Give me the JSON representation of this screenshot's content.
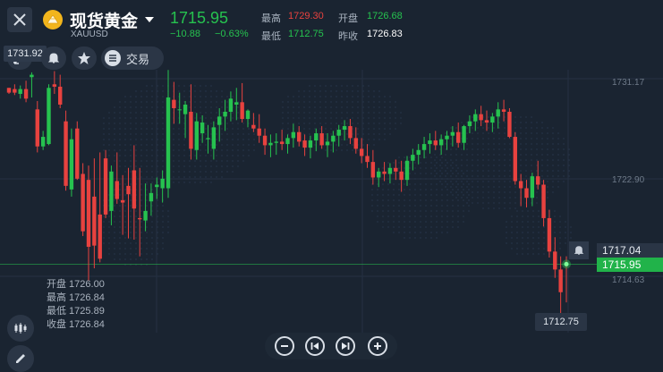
{
  "header": {
    "title": "现货黄金",
    "symbol": "XAUUSD",
    "price": "1715.95",
    "change": "−10.88",
    "change_pct": "−0.63%",
    "stats": {
      "high_label": "最高",
      "high_value": "1729.30",
      "open_label": "开盘",
      "open_value": "1726.68",
      "low_label": "最低",
      "low_value": "1712.75",
      "prev_label": "昨收",
      "prev_value": "1726.83"
    }
  },
  "toolbar": {
    "trade_label": "交易",
    "top_left_price": "1731.92"
  },
  "axis": {
    "labels": [
      "1731.17",
      "1722.90",
      "1714.63"
    ],
    "current_high": "1717.04",
    "current": "1715.95",
    "low_marker": "1712.75"
  },
  "ohlc": {
    "open": "开盘 1726.00",
    "high": "最高 1726.84",
    "low": "最低 1725.89",
    "close": "收盘 1726.84"
  },
  "colors": {
    "up": "#26c24f",
    "down": "#e8423f",
    "background": "#1a2431",
    "current_price_bg": "#21b34a"
  },
  "controls": [
    "zoom-out",
    "step-back",
    "step-forward",
    "zoom-in"
  ],
  "chart_data": {
    "type": "candlestick",
    "y_axis": {
      "ticks": [
        1731.17,
        1722.9,
        1714.63
      ]
    },
    "last": 1715.95,
    "low": 1712.75,
    "candles": [
      [
        1730.7,
        1730.7,
        1730.2,
        1730.3
      ],
      [
        1730.6,
        1731.0,
        1730.1,
        1730.3
      ],
      [
        1730.2,
        1730.9,
        1729.8,
        1730.6
      ],
      [
        1730.6,
        1731.3,
        1729.5,
        1729.8
      ],
      [
        1731.6,
        1732.0,
        1729.9,
        1731.8
      ],
      [
        1728.9,
        1729.6,
        1725.3,
        1725.8
      ],
      [
        1725.8,
        1727.1,
        1725.5,
        1726.6
      ],
      [
        1726.0,
        1731.0,
        1725.9,
        1730.7
      ],
      [
        1731.0,
        1732.1,
        1730.2,
        1730.8
      ],
      [
        1730.8,
        1731.8,
        1729.0,
        1729.3
      ],
      [
        1727.9,
        1728.8,
        1722.1,
        1722.5
      ],
      [
        1722.2,
        1727.3,
        1721.6,
        1726.4
      ],
      [
        1727.3,
        1727.9,
        1723.0,
        1723.1
      ],
      [
        1723.5,
        1724.4,
        1718.3,
        1718.7
      ],
      [
        1723.0,
        1724.2,
        1714.6,
        1717.4
      ],
      [
        1721.6,
        1724.8,
        1715.6,
        1717.5
      ],
      [
        1720.1,
        1725.3,
        1716.1,
        1716.4
      ],
      [
        1724.8,
        1725.5,
        1719.8,
        1720.1
      ],
      [
        1720.4,
        1724.2,
        1719.2,
        1723.7
      ],
      [
        1722.9,
        1725.3,
        1721.0,
        1721.4
      ],
      [
        1721.3,
        1723.4,
        1718.4,
        1721.1
      ],
      [
        1722.5,
        1724.0,
        1718.1,
        1721.8
      ],
      [
        1723.8,
        1725.9,
        1718.0,
        1720.6
      ],
      [
        1719.8,
        1724.0,
        1716.6,
        1719.7
      ],
      [
        1719.6,
        1722.7,
        1718.7,
        1720.4
      ],
      [
        1721.2,
        1722.7,
        1720.0,
        1721.9
      ],
      [
        1722.4,
        1723.2,
        1721.4,
        1722.6
      ],
      [
        1722.3,
        1723.8,
        1721.1,
        1723.1
      ],
      [
        1722.3,
        1732.2,
        1721.5,
        1729.9
      ],
      [
        1729.7,
        1731.2,
        1727.7,
        1729.0
      ],
      [
        1728.9,
        1730.3,
        1727.7,
        1728.9
      ],
      [
        1728.5,
        1729.6,
        1726.5,
        1729.3
      ],
      [
        1728.7,
        1731.0,
        1724.7,
        1725.6
      ],
      [
        1725.5,
        1728.6,
        1724.7,
        1727.9
      ],
      [
        1726.9,
        1728.4,
        1726.1,
        1727.8
      ],
      [
        1726.4,
        1727.6,
        1725.2,
        1726.5
      ],
      [
        1725.6,
        1727.9,
        1724.7,
        1727.4
      ],
      [
        1727.6,
        1729.0,
        1726.2,
        1728.3
      ],
      [
        1728.3,
        1729.7,
        1727.1,
        1728.7
      ],
      [
        1728.7,
        1730.4,
        1727.9,
        1729.8
      ],
      [
        1729.3,
        1730.7,
        1728.0,
        1729.5
      ],
      [
        1729.5,
        1731.1,
        1727.8,
        1728.1
      ],
      [
        1728.1,
        1728.9,
        1727.4,
        1728.8
      ],
      [
        1727.6,
        1728.6,
        1727.0,
        1727.3
      ],
      [
        1727.3,
        1728.5,
        1726.1,
        1726.7
      ],
      [
        1726.7,
        1727.3,
        1725.1,
        1725.9
      ],
      [
        1725.9,
        1726.8,
        1724.9,
        1726.1
      ],
      [
        1726.1,
        1726.9,
        1725.1,
        1726.2
      ],
      [
        1726.2,
        1727.2,
        1725.5,
        1726.0
      ],
      [
        1726.0,
        1726.8,
        1725.2,
        1726.5
      ],
      [
        1726.5,
        1727.7,
        1725.7,
        1727.0
      ],
      [
        1727.0,
        1727.5,
        1725.8,
        1726.2
      ],
      [
        1726.3,
        1726.8,
        1725.0,
        1725.7
      ],
      [
        1725.7,
        1726.7,
        1724.8,
        1726.3
      ],
      [
        1726.3,
        1727.3,
        1725.4,
        1726.9
      ],
      [
        1726.9,
        1727.5,
        1725.6,
        1725.9
      ],
      [
        1725.9,
        1726.9,
        1724.9,
        1726.2
      ],
      [
        1726.2,
        1727.1,
        1725.3,
        1726.7
      ],
      [
        1726.7,
        1727.6,
        1725.8,
        1727.2
      ],
      [
        1727.2,
        1728.0,
        1726.3,
        1727.5
      ],
      [
        1727.5,
        1728.1,
        1726.0,
        1726.5
      ],
      [
        1726.5,
        1727.4,
        1725.2,
        1725.6
      ],
      [
        1725.6,
        1726.5,
        1724.4,
        1725.0
      ],
      [
        1725.0,
        1726.0,
        1724.0,
        1724.5
      ],
      [
        1724.5,
        1725.5,
        1722.6,
        1723.2
      ],
      [
        1723.2,
        1724.0,
        1722.4,
        1723.7
      ],
      [
        1723.7,
        1724.5,
        1722.9,
        1723.5
      ],
      [
        1723.5,
        1724.4,
        1722.7,
        1724.0
      ],
      [
        1724.0,
        1724.7,
        1723.0,
        1723.7
      ],
      [
        1723.7,
        1724.6,
        1722.0,
        1723.0
      ],
      [
        1723.0,
        1725.0,
        1722.5,
        1724.6
      ],
      [
        1724.6,
        1725.6,
        1723.8,
        1725.1
      ],
      [
        1725.1,
        1726.0,
        1724.3,
        1725.5
      ],
      [
        1725.5,
        1726.6,
        1724.8,
        1726.0
      ],
      [
        1726.0,
        1726.9,
        1725.2,
        1726.3
      ],
      [
        1726.3,
        1727.1,
        1725.5,
        1725.9
      ],
      [
        1725.9,
        1726.8,
        1725.1,
        1726.4
      ],
      [
        1726.4,
        1727.1,
        1725.5,
        1726.7
      ],
      [
        1726.7,
        1727.5,
        1725.8,
        1727.0
      ],
      [
        1727.0,
        1727.8,
        1725.7,
        1726.1
      ],
      [
        1726.1,
        1727.6,
        1725.5,
        1727.5
      ],
      [
        1727.5,
        1728.4,
        1726.9,
        1727.9
      ],
      [
        1727.9,
        1728.9,
        1727.1,
        1728.5
      ],
      [
        1728.5,
        1729.2,
        1727.5,
        1728.0
      ],
      [
        1728.0,
        1728.8,
        1727.1,
        1727.8
      ],
      [
        1727.8,
        1728.6,
        1727.0,
        1728.3
      ],
      [
        1728.3,
        1729.5,
        1727.3,
        1728.9
      ],
      [
        1728.9,
        1729.7,
        1727.9,
        1728.7
      ],
      [
        1728.7,
        1729.0,
        1726.5,
        1726.6
      ],
      [
        1726.6,
        1727.0,
        1722.6,
        1722.9
      ],
      [
        1722.9,
        1723.5,
        1720.8,
        1722.3
      ],
      [
        1722.3,
        1723.0,
        1720.7,
        1721.5
      ],
      [
        1721.5,
        1723.6,
        1720.8,
        1723.3
      ],
      [
        1723.3,
        1724.6,
        1722.2,
        1722.6
      ],
      [
        1722.6,
        1723.0,
        1719.1,
        1719.8
      ],
      [
        1719.8,
        1720.5,
        1716.5,
        1717.0
      ],
      [
        1717.0,
        1718.2,
        1714.8,
        1715.5
      ],
      [
        1715.5,
        1716.6,
        1711.4,
        1713.6
      ],
      [
        1716.0,
        1716.6,
        1712.75,
        1715.95
      ]
    ]
  }
}
